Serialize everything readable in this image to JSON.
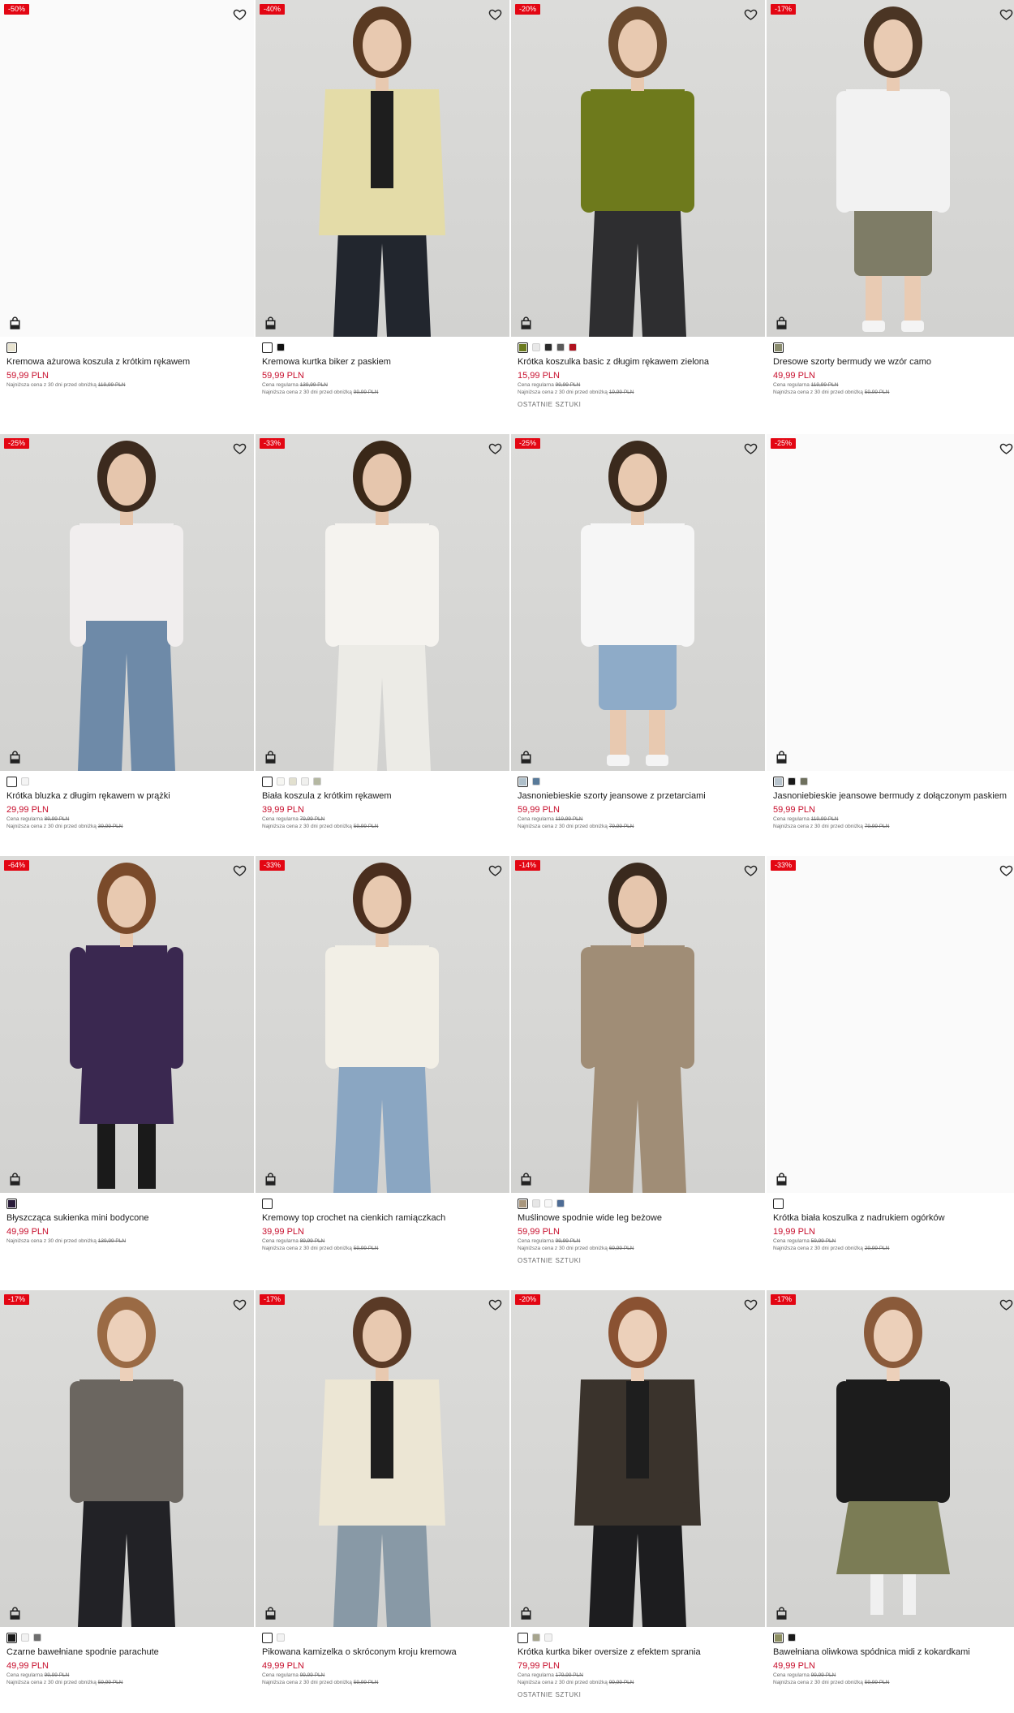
{
  "products": [
    {
      "badge": "-50%",
      "name": "Kremowa ażurowa koszula z krótkim rękawem",
      "price": "59,99 PLN",
      "regular_label": "",
      "regular_price": "",
      "lowest_label": "Najniższa cena z 30 dni przed obniżką",
      "lowest_price": "119,99 PLN",
      "last_items": "",
      "colors": [
        "#e8e3cf"
      ],
      "image": "blank"
    },
    {
      "badge": "-40%",
      "name": "Kremowa kurtka biker z paskiem",
      "price": "59,99 PLN",
      "regular_label": "Cena regularna",
      "regular_price": "139,99 PLN",
      "lowest_label": "Najniższa cena z 30 dni przed obniżką",
      "lowest_price": "99,99 PLN",
      "last_items": "",
      "colors": [
        "#ffffff",
        "#111111"
      ],
      "image": "jacket-cream"
    },
    {
      "badge": "-20%",
      "name": "Krótka koszulka basic z długim rękawem zielona",
      "price": "15,99 PLN",
      "regular_label": "Cena regularna",
      "regular_price": "99,99 PLN",
      "lowest_label": "Najniższa cena z 30 dni przed obniżką",
      "lowest_price": "19,99 PLN",
      "last_items": "OSTATNIE SZTUKI",
      "colors": [
        "#6b7a1e",
        "#e8e8e8",
        "#2b2b2b",
        "#5a5a5a",
        "#b0121f"
      ],
      "image": "olive-top"
    },
    {
      "badge": "-17%",
      "name": "Dresowe szorty bermudy we wzór camo",
      "price": "49,99 PLN",
      "regular_label": "Cena regularna",
      "regular_price": "119,99 PLN",
      "lowest_label": "Najniższa cena z 30 dni przed obniżką",
      "lowest_price": "59,99 PLN",
      "last_items": "",
      "colors": [
        "#8a8c6e"
      ],
      "image": "camo-shorts"
    },
    {
      "badge": "-25%",
      "name": "Krótka bluzka z długim rękawem w prążki",
      "price": "29,99 PLN",
      "regular_label": "Cena regularna",
      "regular_price": "89,99 PLN",
      "lowest_label": "Najniższa cena z 30 dni przed obniżką",
      "lowest_price": "39,99 PLN",
      "last_items": "",
      "colors": [
        "#ffffff",
        "#f4f4f4"
      ],
      "image": "white-blouse"
    },
    {
      "badge": "-33%",
      "name": "Biała koszula z krótkim rękawem",
      "price": "39,99 PLN",
      "regular_label": "Cena regularna",
      "regular_price": "79,99 PLN",
      "lowest_label": "Najniższa cena z 30 dni przed obniżką",
      "lowest_price": "59,99 PLN",
      "last_items": "",
      "colors": [
        "#ffffff",
        "#f6f6f2",
        "#e2e0cf",
        "#f0f0ee",
        "#b5b8a2"
      ],
      "image": "white-shirt"
    },
    {
      "badge": "-25%",
      "name": "Jasnoniebieskie szorty jeansowe z przetarciami",
      "price": "59,99 PLN",
      "regular_label": "Cena regularna",
      "regular_price": "119,99 PLN",
      "lowest_label": "Najniższa cena z 30 dni przed obniżką",
      "lowest_price": "79,99 PLN",
      "last_items": "",
      "colors": [
        "#aebfca",
        "#587a99"
      ],
      "image": "denim-shorts"
    },
    {
      "badge": "-25%",
      "name": "Jasnoniebieskie jeansowe bermudy z dołączonym paskiem",
      "price": "59,99 PLN",
      "regular_label": "Cena regularna",
      "regular_price": "119,99 PLN",
      "lowest_label": "Najniższa cena z 30 dni przed obniżką",
      "lowest_price": "79,99 PLN",
      "last_items": "",
      "colors": [
        "#b7c3cc",
        "#1a1a1a",
        "#6f705e"
      ],
      "image": "blank"
    },
    {
      "badge": "-64%",
      "name": "Błyszcząca sukienka mini bodycone",
      "price": "49,99 PLN",
      "regular_label": "",
      "regular_price": "",
      "lowest_label": "Najniższa cena z 30 dni przed obniżką",
      "lowest_price": "139,99 PLN",
      "last_items": "",
      "colors": [
        "#2a1c3a"
      ],
      "image": "sequin-dress"
    },
    {
      "badge": "-33%",
      "name": "Kremowy top crochet na cienkich ramiączkach",
      "price": "39,99 PLN",
      "regular_label": "Cena regularna",
      "regular_price": "89,99 PLN",
      "lowest_label": "Najniższa cena z 30 dni przed obniżką",
      "lowest_price": "59,99 PLN",
      "last_items": "",
      "colors": [
        "#ffffff"
      ],
      "image": "crochet-top"
    },
    {
      "badge": "-14%",
      "name": "Muślinowe spodnie wide leg beżowe",
      "price": "59,99 PLN",
      "regular_label": "Cena regularna",
      "regular_price": "99,99 PLN",
      "lowest_label": "Najniższa cena z 30 dni przed obniżką",
      "lowest_price": "69,99 PLN",
      "last_items": "OSTATNIE SZTUKI",
      "colors": [
        "#a9977d",
        "#e6e6e6",
        "#f8f8f8",
        "#4e6c95"
      ],
      "image": "beige-set"
    },
    {
      "badge": "-33%",
      "name": "Krótka biała koszulka z nadrukiem ogórków",
      "price": "19,99 PLN",
      "regular_label": "Cena regularna",
      "regular_price": "59,99 PLN",
      "lowest_label": "Najniższa cena z 30 dni przed obniżką",
      "lowest_price": "29,99 PLN",
      "last_items": "",
      "colors": [
        "#ffffff"
      ],
      "image": "blank"
    },
    {
      "badge": "-17%",
      "name": "Czarne bawełniane spodnie parachute",
      "price": "49,99 PLN",
      "regular_label": "Cena regularna",
      "regular_price": "99,99 PLN",
      "lowest_label": "Najniższa cena z 30 dni przed obniżką",
      "lowest_price": "59,99 PLN",
      "last_items": "",
      "colors": [
        "#1a1a1a",
        "#f2f2f2",
        "#6e6e6e"
      ],
      "image": "black-pants"
    },
    {
      "badge": "-17%",
      "name": "Pikowana kamizelka o skróconym kroju kremowa",
      "price": "49,99 PLN",
      "regular_label": "Cena regularna",
      "regular_price": "99,99 PLN",
      "lowest_label": "Najniższa cena z 30 dni przed obniżką",
      "lowest_price": "59,99 PLN",
      "last_items": "",
      "colors": [
        "#ffffff",
        "#f3f3f3"
      ],
      "image": "puffer-vest"
    },
    {
      "badge": "-20%",
      "name": "Krótka kurtka biker oversize z efektem sprania",
      "price": "79,99 PLN",
      "regular_label": "Cena regularna",
      "regular_price": "179,99 PLN",
      "lowest_label": "Najniższa cena z 30 dni przed obniżką",
      "lowest_price": "99,99 PLN",
      "last_items": "OSTATNIE SZTUKI",
      "colors": [
        "#ffffff",
        "#a7a58e",
        "#f2f2f2"
      ],
      "image": "leather-jacket"
    },
    {
      "badge": "-17%",
      "name": "Bawełniana oliwkowa spódnica midi z kokardkami",
      "price": "49,99 PLN",
      "regular_label": "Cena regularna",
      "regular_price": "99,99 PLN",
      "lowest_label": "Najniższa cena z 30 dni przed obniżką",
      "lowest_price": "59,99 PLN",
      "last_items": "",
      "colors": [
        "#8d8f62",
        "#1a1a1a"
      ],
      "image": "olive-skirt"
    }
  ],
  "icons": {
    "wishlist": "heart-icon",
    "cart": "shopping-bag-icon"
  },
  "accent_color": "#e30613",
  "price_color": "#c8102e"
}
